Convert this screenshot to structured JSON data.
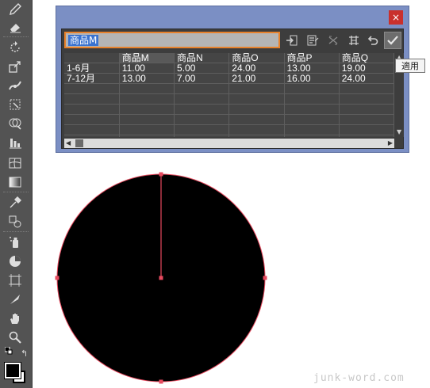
{
  "toolbar": {
    "tools": [
      "pencil-icon",
      "eraser-icon",
      "rotate-icon",
      "scale-icon",
      "width-icon",
      "free-transform-icon",
      "shape-builder-icon",
      "graph-icon",
      "mesh-icon",
      "gradient-icon",
      "eyedropper-icon",
      "blend-icon",
      "symbol-sprayer-icon",
      "pie-graph-icon",
      "artboard-icon",
      "slice-icon",
      "hand-icon",
      "zoom-icon"
    ]
  },
  "dialog": {
    "close_label": "×",
    "cell_value": "商品M",
    "tooltip": "適用",
    "columns": [
      "",
      "商品M",
      "商品N",
      "商品O",
      "商品P",
      "商品Q"
    ],
    "rows": [
      [
        "1-6月",
        "11.00",
        "5.00",
        "24.00",
        "13.00",
        "19.00"
      ],
      [
        "7-12月",
        "13.00",
        "7.00",
        "21.00",
        "16.00",
        "24.00"
      ],
      [
        "",
        "",
        "",
        "",
        "",
        ""
      ],
      [
        "",
        "",
        "",
        "",
        "",
        ""
      ],
      [
        "",
        "",
        "",
        "",
        "",
        ""
      ],
      [
        "",
        "",
        "",
        "",
        "",
        ""
      ],
      [
        "",
        "",
        "",
        "",
        "",
        ""
      ],
      [
        "",
        "",
        "",
        "",
        "",
        ""
      ]
    ],
    "buttons": [
      "import-data-icon",
      "transpose-icon",
      "switch-xy-icon",
      "cell-style-icon",
      "revert-icon",
      "apply-icon"
    ]
  },
  "artwork": {
    "fill_color": "#000000",
    "selection_color": "#e84a5f"
  },
  "watermark": "junk-word.com"
}
